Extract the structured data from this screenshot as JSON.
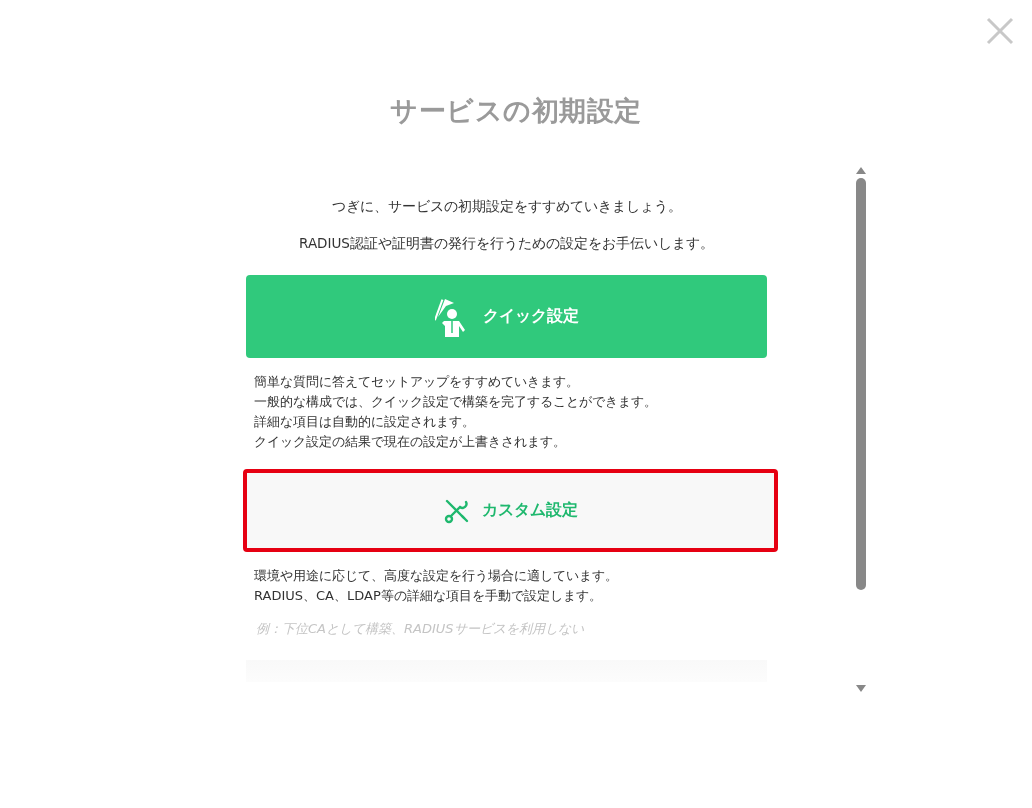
{
  "title": "サービスの初期設定",
  "intro": [
    "つぎに、サービスの初期設定をすすめていきましょう。",
    "RADIUS認証や証明書の発行を行うための設定をお手伝いします。"
  ],
  "options": [
    {
      "kind": "quick",
      "label": "クイック設定",
      "highlighted": false,
      "description": [
        "簡単な質問に答えてセットアップをすすめていきます。",
        "一般的な構成では、クイック設定で構築を完了することができます。",
        "詳細な項目は自動的に設定されます。",
        "クイック設定の結果で現在の設定が上書きされます。"
      ]
    },
    {
      "kind": "custom",
      "label": "カスタム設定",
      "highlighted": true,
      "description": [
        "環境や用途に応じて、高度な設定を行う場合に適しています。",
        "RADIUS、CA、LDAP等の詳細な項目を手動で設定します。"
      ],
      "example": "例：下位CAとして構築、RADIUSサービスを利用しない"
    }
  ]
}
